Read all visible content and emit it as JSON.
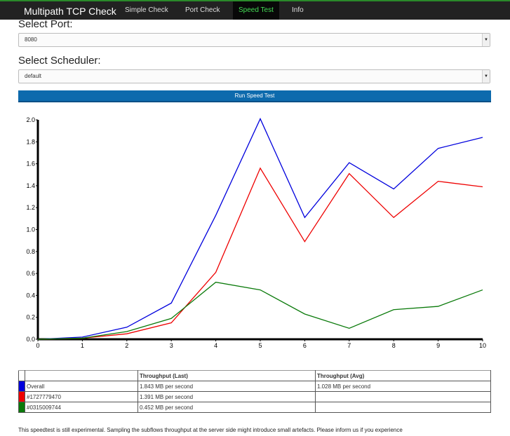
{
  "nav": {
    "brand": "Multipath TCP Check",
    "items": [
      {
        "label": "Simple Check",
        "active": false
      },
      {
        "label": "Port Check",
        "active": false
      },
      {
        "label": "Speed Test",
        "active": true
      },
      {
        "label": "Info",
        "active": false
      }
    ]
  },
  "form": {
    "port_label": "Select Port:",
    "port_value": "8080",
    "scheduler_label": "Select Scheduler:",
    "scheduler_value": "default",
    "run_button": "Run Speed Test"
  },
  "chart_data": {
    "type": "line",
    "x": [
      0,
      1,
      2,
      3,
      4,
      5,
      6,
      7,
      8,
      9,
      10
    ],
    "xlim": [
      0,
      10
    ],
    "ylim": [
      0,
      2.0
    ],
    "xticks": [
      "0",
      "1",
      "2",
      "3",
      "4",
      "5",
      "6",
      "7",
      "8",
      "9",
      "10"
    ],
    "yticks": [
      "0.0",
      "0.2",
      "0.4",
      "0.6",
      "0.8",
      "1.0",
      "1.2",
      "1.4",
      "1.6",
      "1.8",
      "2.0"
    ],
    "grid": false,
    "series": [
      {
        "color": "#0000dd",
        "values": [
          0.0,
          0.02,
          0.11,
          0.33,
          1.13,
          2.01,
          1.11,
          1.61,
          1.37,
          1.74,
          1.84
        ]
      },
      {
        "color": "#ee0000",
        "values": [
          0.0,
          0.01,
          0.05,
          0.15,
          0.61,
          1.56,
          0.89,
          1.51,
          1.11,
          1.44,
          1.39
        ]
      },
      {
        "color": "#0a7a0a",
        "values": [
          0.0,
          0.01,
          0.07,
          0.19,
          0.52,
          0.45,
          0.23,
          0.1,
          0.27,
          0.3,
          0.45
        ]
      }
    ]
  },
  "table": {
    "headers": [
      "",
      "",
      "Throughput (Last)",
      "Throughput (Avg)"
    ],
    "rows": [
      {
        "color": "#0000dd",
        "name": "Overall",
        "last": "1.843 MB per second",
        "avg": "1.028 MB per second"
      },
      {
        "color": "#ee0000",
        "name": "#1727779470",
        "last": "1.391 MB per second",
        "avg": ""
      },
      {
        "color": "#0a7a0a",
        "name": "#0315009744",
        "last": "0.452 MB per second",
        "avg": ""
      }
    ]
  },
  "footer": {
    "note": "This speedtest is still experimental. Sampling the subflows throughput at the server side might introduce small artefacts. Please inform us if you experience"
  }
}
